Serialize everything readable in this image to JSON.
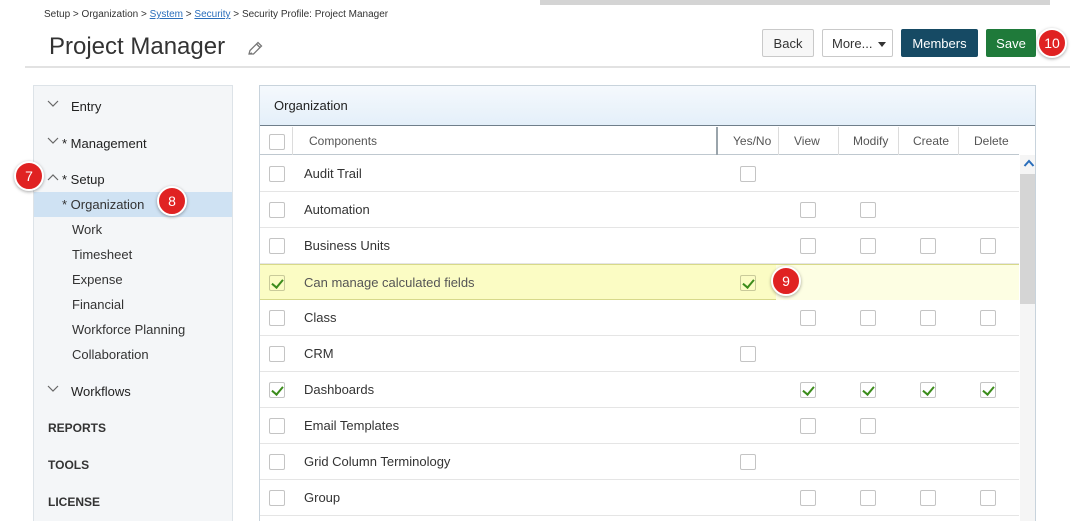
{
  "breadcrumb": {
    "setup": "Setup",
    "sep1": " > ",
    "organization": "Organization",
    "sep2": " > ",
    "system": "System",
    "sep3": " > ",
    "security": "Security",
    "sep4": " > ",
    "profile": "Security Profile: Project Manager"
  },
  "header": {
    "title": "Project Manager",
    "back_label": "Back",
    "more_label": "More...",
    "members_label": "Members",
    "save_label": "Save"
  },
  "badges": {
    "b7": "7",
    "b8": "8",
    "b9": "9",
    "b10": "10"
  },
  "sidebar": {
    "entry": "Entry",
    "management": "* Management",
    "setup": "* Setup",
    "organization": "* Organization",
    "work": "Work",
    "timesheet": "Timesheet",
    "expense": "Expense",
    "financial": "Financial",
    "workforce": "Workforce Planning",
    "collaboration": "Collaboration",
    "workflows": "Workflows",
    "reports": "REPORTS",
    "tools": "TOOLS",
    "license": "LICENSE"
  },
  "panel": {
    "title": "Organization",
    "columns": {
      "components": "Components",
      "yesno": "Yes/No",
      "view": "View",
      "modify": "Modify",
      "create": "Create",
      "delete": "Delete"
    }
  },
  "rows": [
    {
      "name": "Audit Trail"
    },
    {
      "name": "Automation"
    },
    {
      "name": "Business Units"
    },
    {
      "name": "Can manage calculated fields"
    },
    {
      "name": "Class"
    },
    {
      "name": "CRM"
    },
    {
      "name": "Dashboards"
    },
    {
      "name": "Email Templates"
    },
    {
      "name": "Grid Column Terminology"
    },
    {
      "name": "Group"
    }
  ],
  "colors": {
    "members": "#164a64",
    "save": "#1f7a3a",
    "badge": "#e02222",
    "highlight": "#fbfcc4"
  }
}
